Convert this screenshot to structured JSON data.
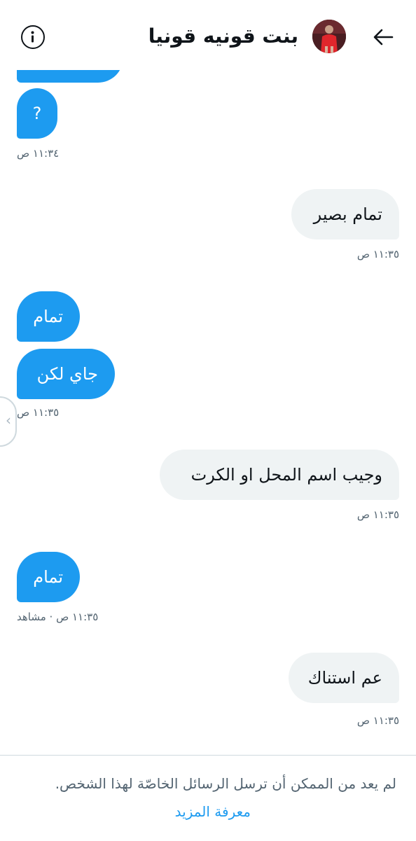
{
  "header": {
    "title": "بنت قونيه قونيا",
    "info_icon": "info-icon",
    "back_icon": "arrow-left-icon"
  },
  "messages": [
    {
      "side": "received",
      "text": "?"
    },
    {
      "side": "received_ts",
      "text": "١١:٣٤ ص"
    },
    {
      "side": "sent",
      "text": "تمام بصير"
    },
    {
      "side": "sent_ts",
      "text": "١١:٣٥ ص"
    },
    {
      "side": "received",
      "text": "تمام"
    },
    {
      "side": "received",
      "text": "جاي لكن"
    },
    {
      "side": "received_ts",
      "text": "١١:٣٥ ص"
    },
    {
      "side": "sent",
      "text": "وجيب اسم المحل او الكرت"
    },
    {
      "side": "sent_ts",
      "text": "١١:٣٥ ص"
    },
    {
      "side": "received",
      "text": "تمام"
    },
    {
      "side": "received_ts",
      "text": "١١:٣٥ ص · مشاهد"
    },
    {
      "side": "sent",
      "text": "عم استناك"
    },
    {
      "side": "sent_ts",
      "text": "١١:٣٥ ص"
    }
  ],
  "footer": {
    "notice": "لم يعد من الممكن أن ترسل الرسائل الخاصّة لهذا الشخص.",
    "learn_more": "معرفة المزيد"
  },
  "colors": {
    "received_bubble": "#1d9bf0",
    "sent_bubble": "#eff3f4",
    "link": "#1d9bf0",
    "secondary_text": "#536471"
  }
}
